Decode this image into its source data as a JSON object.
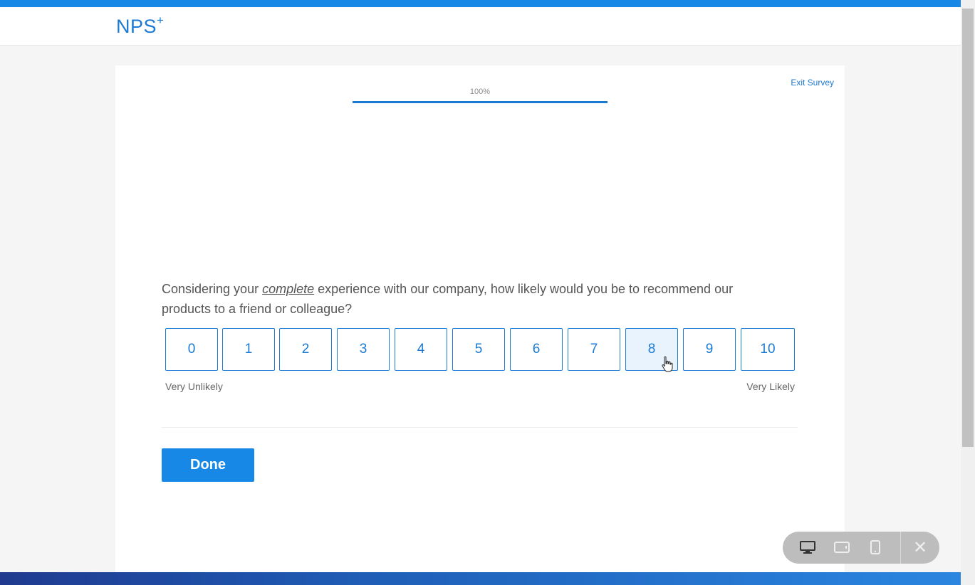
{
  "app": {
    "logo": "NPS",
    "logo_suffix": "+"
  },
  "survey": {
    "exit_label": "Exit Survey",
    "progress_label": "100%",
    "progress_value": 1.0,
    "question_before": "Considering your ",
    "question_emphasis": "complete",
    "question_after": " experience with our company, how likely would you be to recommend our products to a friend or colleague?",
    "options": [
      "0",
      "1",
      "2",
      "3",
      "4",
      "5",
      "6",
      "7",
      "8",
      "9",
      "10"
    ],
    "hovered_option": "8",
    "low_label": "Very Unlikely",
    "high_label": "Very Likely",
    "done_label": "Done"
  },
  "device_toolbar": {
    "icons": [
      "desktop-icon",
      "tablet-icon",
      "phone-icon"
    ],
    "close_icon": "close-icon"
  },
  "colors": {
    "accent": "#1788e6",
    "accent_text": "#1a7ad4",
    "hover_fill": "#e8f3fd"
  }
}
